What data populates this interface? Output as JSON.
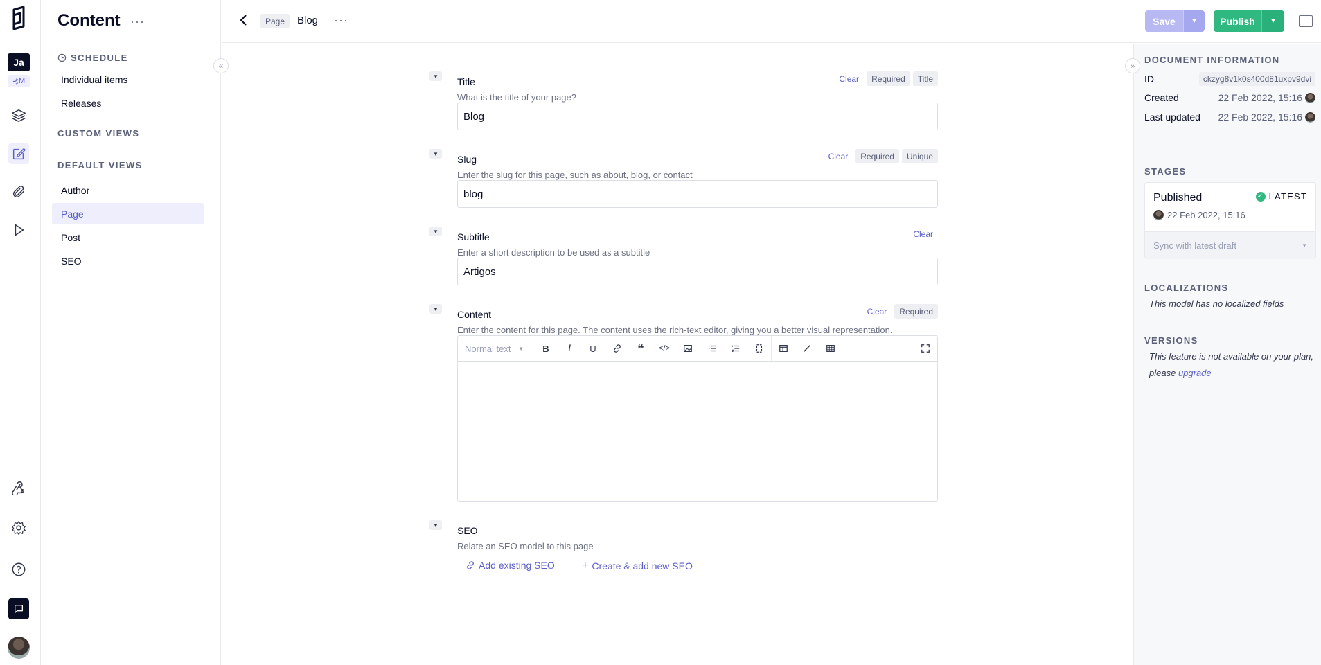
{
  "rail": {
    "workspace_initials": "Ja",
    "environment_label": "M",
    "icons": [
      "logo-icon",
      "layers-icon",
      "edit-icon",
      "paperclip-icon",
      "play-icon",
      "webhook-icon",
      "gear-icon",
      "help-icon",
      "chat-icon"
    ]
  },
  "nav": {
    "title": "Content",
    "more": "···",
    "schedule_label": "SCHEDULE",
    "schedule_items": [
      "Individual items",
      "Releases"
    ],
    "custom_views_label": "CUSTOM VIEWS",
    "default_views_label": "DEFAULT VIEWS",
    "default_items": [
      "Author",
      "Page",
      "Post",
      "SEO"
    ],
    "selected_item": "Page"
  },
  "topbar": {
    "model_badge": "Page",
    "entry_title": "Blog",
    "more": "···",
    "save_label": "Save",
    "publish_label": "Publish"
  },
  "form": {
    "title": {
      "label": "Title",
      "help": "What is the title of your page?",
      "value": "Blog",
      "clear": "Clear",
      "tags": [
        "Required",
        "Title"
      ]
    },
    "slug": {
      "label": "Slug",
      "help": "Enter the slug for this page, such as about, blog, or contact",
      "value": "blog",
      "clear": "Clear",
      "tags": [
        "Required",
        "Unique"
      ]
    },
    "subtitle": {
      "label": "Subtitle",
      "help": "Enter a short description to be used as a subtitle",
      "value": "Artigos",
      "clear": "Clear"
    },
    "content": {
      "label": "Content",
      "help": "Enter the content for this page. The content uses the rich-text editor, giving you a better visual representation.",
      "clear": "Clear",
      "tags": [
        "Required"
      ],
      "text_style": "Normal text"
    },
    "seo": {
      "label": "SEO",
      "help": "Relate an SEO model to this page",
      "add_existing": "Add existing SEO",
      "create_new": "Create & add new SEO"
    }
  },
  "panel": {
    "doc_info_label": "DOCUMENT INFORMATION",
    "id_label": "ID",
    "id_value": "ckzyg8v1k0s400d81uxpv9dvi",
    "created_label": "Created",
    "created_value": "22 Feb 2022, 15:16",
    "updated_label": "Last updated",
    "updated_value": "22 Feb 2022, 15:16",
    "stages_label": "STAGES",
    "stage_name": "Published",
    "stage_badge": "LATEST",
    "stage_date": "22 Feb 2022, 15:16",
    "sync_label": "Sync with latest draft",
    "localizations_label": "LOCALIZATIONS",
    "localizations_note": "This model has no localized fields",
    "versions_label": "VERSIONS",
    "versions_note": "This feature is not available on your plan, please",
    "versions_link": "upgrade"
  },
  "colors": {
    "accent": "#5b5fc7",
    "publish": "#2fb981",
    "save_disabled": "#b8b9f3"
  }
}
